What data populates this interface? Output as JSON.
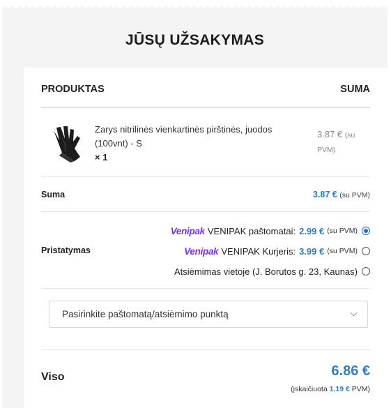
{
  "title": "JŪSŲ UŽSAKYMAS",
  "table": {
    "col_product": "PRODUKTAS",
    "col_sum": "SUMA"
  },
  "product": {
    "name": "Zarys nitrilinės vienkartinės pirštinės, juodos (100vnt) - S",
    "qty": "× 1",
    "price": "3.87 €",
    "price_note": "(su PVM)"
  },
  "subtotal": {
    "label": "Suma",
    "value": "3.87 €",
    "note": "(su PVM)"
  },
  "shipping": {
    "label": "Pristatymas",
    "options": [
      {
        "logo": "Venipak",
        "label": "VENIPAK paštomatai:",
        "price": "2.99 €",
        "note": "(su PVM)",
        "selected": true
      },
      {
        "logo": "Venipak",
        "label": "VENIPAK Kurjeris:",
        "price": "3.99 €",
        "note": "(su PVM)",
        "selected": false
      },
      {
        "logo": "",
        "label": "Atsiėmimas vietoje (J. Borutos g. 23, Kaunas)",
        "price": "",
        "note": "",
        "selected": false
      }
    ]
  },
  "pickup_select": {
    "placeholder": "Pasirinkite paštomatą/atsiėmimo punktą"
  },
  "total": {
    "label": "Viso",
    "value": "6.86 €",
    "tax_prefix": "(įskaičiuota",
    "tax_value": "1.19 €",
    "tax_suffix": "PVM)"
  },
  "colors": {
    "accent_blue": "#2d7fc1",
    "venipak_purple": "#7b2ff0",
    "radio_selected": "#1e6fd9"
  },
  "icons": {
    "product_image": "black-glove-image",
    "select_arrow": "chevron-down-icon"
  }
}
